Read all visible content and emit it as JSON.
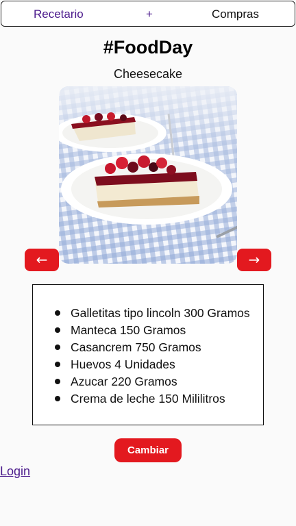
{
  "nav": {
    "recetario": "Recetario",
    "add": "+",
    "compras": "Compras"
  },
  "page": {
    "title": "#FoodDay",
    "recipe_name": "Cheesecake"
  },
  "carousel": {
    "prev_label": "←",
    "next_label": "→"
  },
  "ingredients": [
    "Galletitas tipo lincoln 300 Gramos",
    "Manteca 150 Gramos",
    "Casancrem 750 Gramos",
    "Huevos 4 Unidades",
    "Azucar 220 Gramos",
    "Crema de leche 150 Mililitros"
  ],
  "actions": {
    "change_label": "Cambiar",
    "login_label": "Login"
  },
  "colors": {
    "accent_red": "#e3191f",
    "link_purple": "#4b1a8c"
  }
}
